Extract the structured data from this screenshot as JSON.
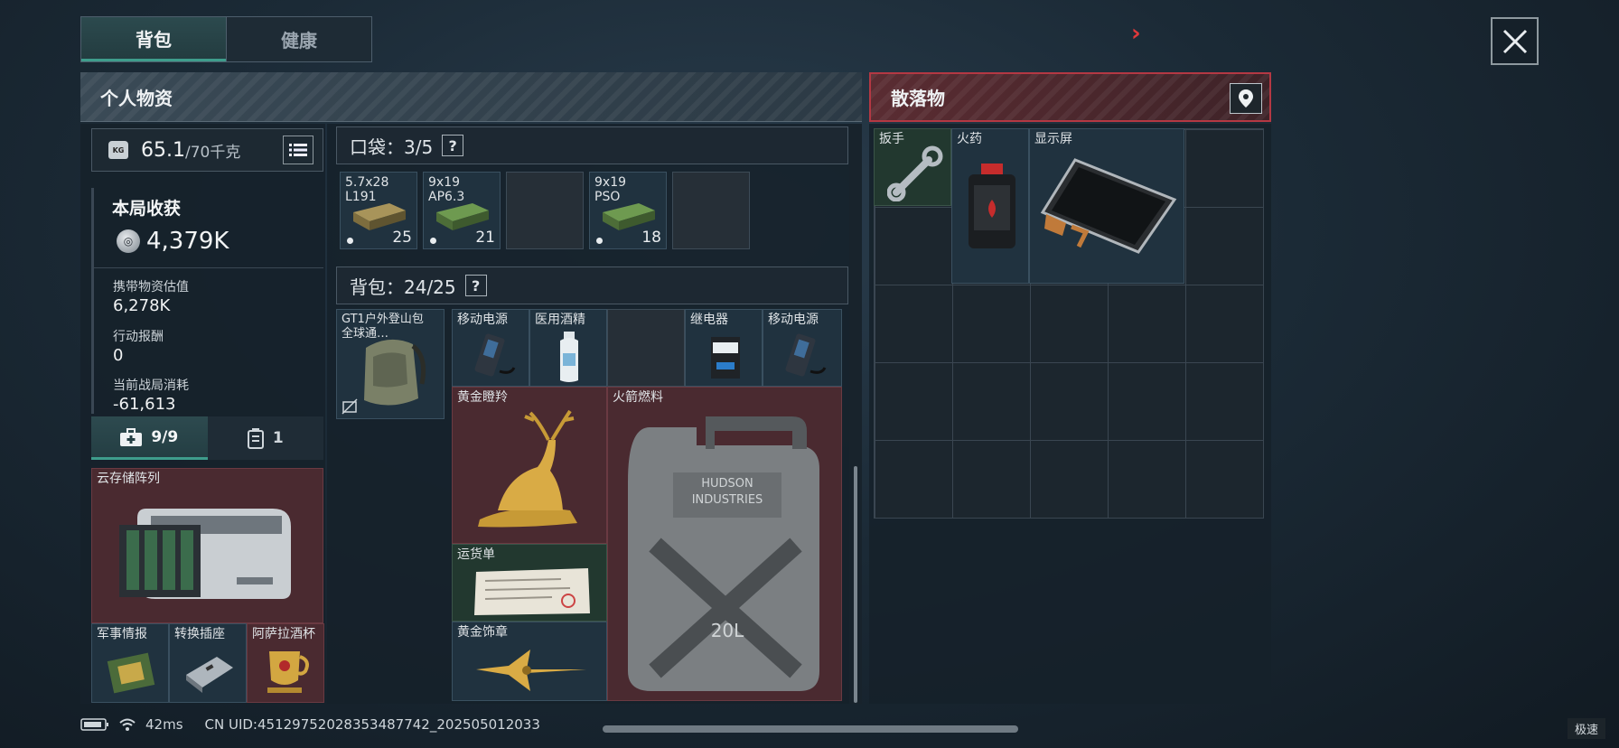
{
  "top_tabs": [
    {
      "label": "背包",
      "active": true
    },
    {
      "label": "健康",
      "active": false
    }
  ],
  "personal": {
    "title": "个人物资",
    "weight": {
      "value": "65.1",
      "max": "/70千克",
      "icon": "kg-weight-icon",
      "kg_text": "KG"
    },
    "harvest": {
      "title": "本局收获",
      "value": "4,379K",
      "stats": [
        {
          "label": "携带物资估值",
          "value": "6,278K"
        },
        {
          "label": "行动报酬",
          "value": "0"
        },
        {
          "label": "当前战局消耗",
          "value": "-61,613"
        }
      ]
    },
    "subtabs": [
      {
        "label": "9/9",
        "icon": "medkit-icon",
        "active": true
      },
      {
        "label": "1",
        "icon": "case-icon",
        "active": false
      }
    ],
    "case_items": [
      {
        "label": "云存储阵列",
        "color": "red"
      },
      {
        "label": "军事情报",
        "color": "blue"
      },
      {
        "label": "转换插座",
        "color": "blue"
      },
      {
        "label": "阿萨拉酒杯",
        "color": "red"
      }
    ]
  },
  "pocket": {
    "label": "口袋：3/5",
    "help": "?",
    "slots": [
      {
        "name": "5.7x28\nL191",
        "count": "25"
      },
      {
        "name": "9x19\nAP6.3",
        "count": "21"
      },
      {
        "name": "",
        "count": ""
      },
      {
        "name": "9x19\nPSO",
        "count": "18"
      },
      {
        "name": "",
        "count": ""
      }
    ]
  },
  "backpack": {
    "label": "背包：24/25",
    "help": "?",
    "equipped": {
      "label": "GT1户外登山包\n全球通…"
    },
    "items": [
      {
        "label": "移动电源",
        "color": "blue"
      },
      {
        "label": "医用酒精",
        "color": "blue"
      },
      {
        "label": "继电器",
        "color": "blue"
      },
      {
        "label": "移动电源",
        "color": "blue"
      },
      {
        "label": "黄金瞪羚",
        "color": "red"
      },
      {
        "label": "火箭燃料",
        "color": "red"
      },
      {
        "label": "运货单",
        "color": "green"
      },
      {
        "label": "黄金饰章",
        "color": "blue"
      }
    ],
    "fuel_can_text": [
      "HUDSON",
      "INDUSTRIES",
      "20L"
    ]
  },
  "scatter": {
    "title": "散落物",
    "items": [
      {
        "label": "扳手",
        "color": "green"
      },
      {
        "label": "火药",
        "color": "blue"
      },
      {
        "label": "显示屏",
        "color": "blue"
      }
    ]
  },
  "status": {
    "ping": "42ms",
    "uid": "CN UID:4512975202835348774​2_20250501203​3",
    "speed": "极速"
  },
  "colors": {
    "accent": "#3e9d8c",
    "red_rarity": "#4a2a30",
    "blue_rarity": "#20323f",
    "green_rarity": "#22382f",
    "alert": "#e0393b"
  }
}
